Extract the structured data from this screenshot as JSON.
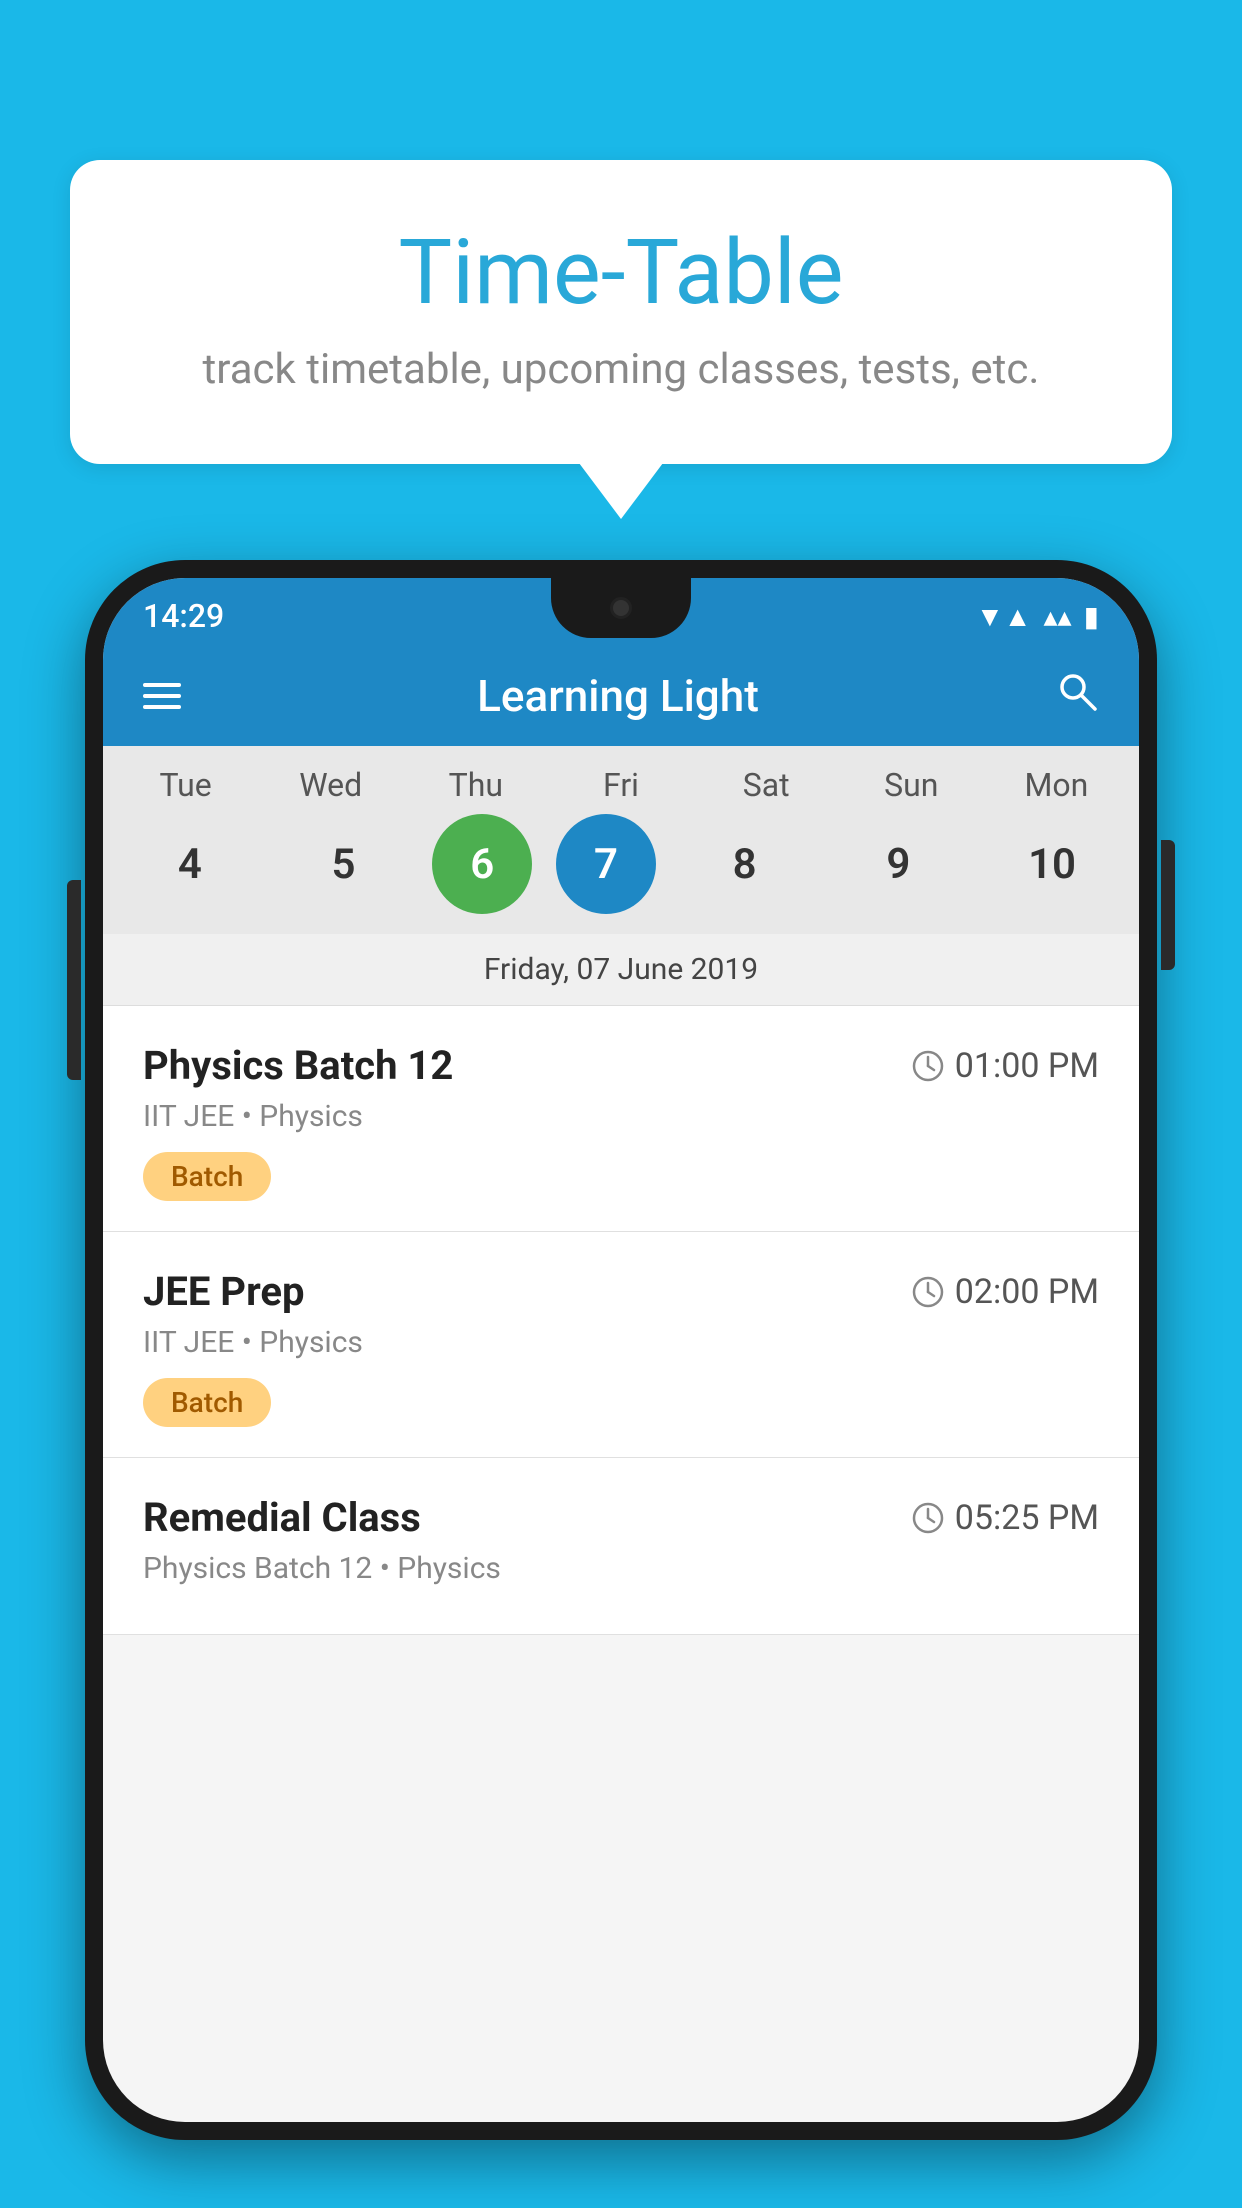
{
  "background_color": "#1ab8e8",
  "bubble": {
    "title": "Time-Table",
    "subtitle": "track timetable, upcoming classes, tests, etc."
  },
  "phone": {
    "status_bar": {
      "time": "14:29",
      "wifi": "▼▲",
      "battery": "▌"
    },
    "header": {
      "title": "Learning Light",
      "hamburger_label": "menu",
      "search_label": "search"
    },
    "calendar": {
      "days": [
        "Tue",
        "Wed",
        "Thu",
        "Fri",
        "Sat",
        "Sun",
        "Mon"
      ],
      "dates": [
        "4",
        "5",
        "6",
        "7",
        "8",
        "9",
        "10"
      ],
      "today_index": 2,
      "selected_index": 3,
      "selected_date_label": "Friday, 07 June 2019"
    },
    "schedule": [
      {
        "title": "Physics Batch 12",
        "time": "01:00 PM",
        "subtitle": "IIT JEE • Physics",
        "badge": "Batch"
      },
      {
        "title": "JEE Prep",
        "time": "02:00 PM",
        "subtitle": "IIT JEE • Physics",
        "badge": "Batch"
      },
      {
        "title": "Remedial Class",
        "time": "05:25 PM",
        "subtitle": "Physics Batch 12 • Physics",
        "badge": ""
      }
    ]
  }
}
